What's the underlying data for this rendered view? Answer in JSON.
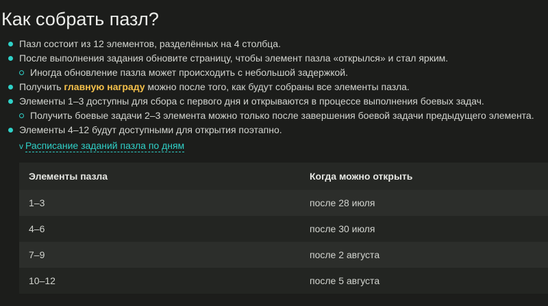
{
  "title": "Как собрать пазл?",
  "bullets": [
    {
      "text": "Пазл состоит из 12 элементов, разделённых на 4 столбца."
    },
    {
      "text": "После выполнения задания обновите страницу, чтобы элемент пазла «открылся» и стал ярким."
    },
    {
      "text": "Иногда обновление пазла может происходить с небольшой задержкой."
    },
    {
      "before": "Получить ",
      "highlight": "главную награду",
      "after": " можно после того, как будут собраны все элементы пазла."
    },
    {
      "text": "Элементы 1–3 доступны для сбора с первого дня и открываются в процессе выполнения боевых задач."
    },
    {
      "text": "Получить боевые задачи 2–3 элемента можно только после завершения боевой задачи предыдущего элемента."
    },
    {
      "text": "Элементы 4–12 будут доступными для открытия поэтапно."
    }
  ],
  "schedule_toggle": {
    "chevron": "v",
    "label": "Расписание заданий пазла по дням"
  },
  "table": {
    "headers": [
      "Элементы пазла",
      "Когда можно открыть"
    ],
    "rows": [
      [
        "1–3",
        "после 28 июля"
      ],
      [
        "4–6",
        "после 30 июля"
      ],
      [
        "7–9",
        "после 2 августа"
      ],
      [
        "10–12",
        "после 5 августа"
      ]
    ]
  },
  "colors": {
    "accent": "#2fd1c8",
    "highlight": "#f5c14b",
    "background": "#1c1d1b"
  }
}
